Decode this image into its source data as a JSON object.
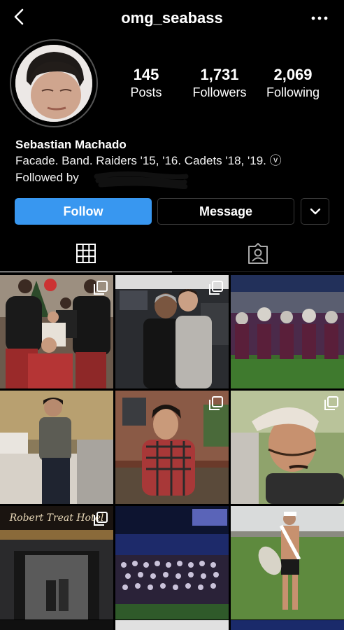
{
  "header": {
    "username": "omg_seabass",
    "back_icon": "back-icon",
    "more_icon": "more-icon"
  },
  "profile": {
    "stats": [
      {
        "value": "145",
        "label": "Posts"
      },
      {
        "value": "1,731",
        "label": "Followers"
      },
      {
        "value": "2,069",
        "label": "Following"
      }
    ],
    "name": "Sebastian Machado",
    "bio": "Facade. Band. Raiders '15, '16. Cadets '18, '19. ⓥ",
    "followed_by": "Followed by"
  },
  "actions": {
    "follow": "Follow",
    "message": "Message",
    "more": "chevron-down-icon"
  },
  "tabs": {
    "grid": "grid-icon",
    "tagged": "tagged-icon"
  },
  "colors": {
    "accent": "#3897f0",
    "background": "#000000",
    "text": "#ffffff"
  },
  "posts": [
    {
      "description": "",
      "multi": true
    },
    {
      "description": "",
      "multi": true
    },
    {
      "description": "",
      "multi": false
    },
    {
      "description": "",
      "multi": false
    },
    {
      "description": "",
      "multi": true
    },
    {
      "description": "",
      "multi": true
    },
    {
      "description": "",
      "multi": true,
      "sign": "Robert Treat Hotel"
    },
    {
      "description": "",
      "multi": false
    },
    {
      "description": "",
      "multi": false
    }
  ]
}
